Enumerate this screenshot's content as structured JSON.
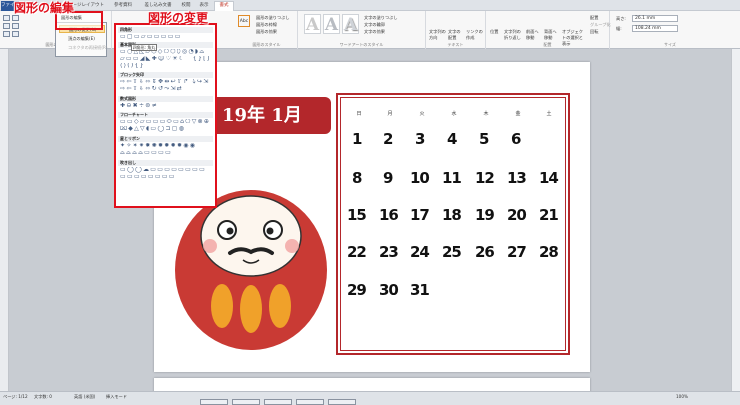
{
  "tabs": {
    "file": "ファイル",
    "items": [
      "ホーム",
      "挿入",
      "ページレイアウト",
      "参考資料",
      "差し込み文書",
      "校閲",
      "表示",
      "書式"
    ]
  },
  "ribbon": {
    "edit_shape": "図形の編集",
    "text_box": "テキスト ボックス",
    "group_insert_shape": "図形の挿入",
    "abc": "Abc",
    "shape_fill": "図形の塗りつぶし",
    "shape_outline": "図形の枠線",
    "shape_effect": "図形の効果",
    "group_shape_style": "図形のスタイル",
    "wordart_a": "A",
    "text_fill": "文字の塗りつぶし",
    "text_outline": "文字の輪郭",
    "text_effect": "文字の効果",
    "group_wordart": "ワードアートのスタイル",
    "text_direction": "文字列の方向",
    "text_align": "文字の配置",
    "create_link": "リンクの作成",
    "group_text": "テキスト",
    "position": "位置",
    "wrap": "文字列の折り返し",
    "forward": "前面へ移動",
    "backward": "背面へ移動",
    "selection_pane": "オブジェクトの選択と表示",
    "align": "配置",
    "group": "グループ化",
    "rotate": "回転",
    "group_arrange": "配置",
    "height_label": "高さ:",
    "height_value": "26.1 mm",
    "width_label": "幅:",
    "width_value": "108.24 mm",
    "group_size": "サイズ"
  },
  "annotations": {
    "edit_shape": "図形の編集",
    "change_shape": "図形の変更"
  },
  "dropdown_menu": {
    "items": [
      {
        "label": "図形の変更(N)",
        "state": "highlighted"
      },
      {
        "label": "頂点の編集(E)",
        "state": "normal"
      },
      {
        "label": "コネクタの再接続(R)",
        "state": "disabled"
      }
    ]
  },
  "shape_gallery": {
    "tooltip": "四角形: 角丸",
    "sections": [
      "四角形",
      "基本図形",
      "ブロック矢印",
      "数式図形",
      "フローチャート",
      "星とリボン",
      "吹き出し"
    ],
    "rows": [
      "▭▢▭▱▭▭▭▭▭",
      "▭○△◺▱⬡◇⬠⬡⬯◎◔◗⌓",
      "▱▭▭◢◣✚☺♡☀☾⌒{}[]",
      "⟨⟩(){}",
      "⇨⇦⇧⇩⬄⇕✥⇹↩⇧↱⤵↪⇲",
      "⇨⇦⇧⇩⬄↻↺⤳⇲⇄",
      "✚⊖✖÷⊜≠",
      "▭▭◇▱▭▭▭⬭▭⌂⬠▽⊗⊕",
      "⌧◆△▽◖▭◯⊐▢◍",
      "✦✧✶✷✸✺✹✹✹✹◉◉",
      "⌓⌓⌓⌓▭▭▭▭",
      "▭◯◯☁▭▭▭▭▭▭▭▭",
      "▭▭▭▭▭▭▭▭"
    ]
  },
  "page": {
    "banner": "19年 1月",
    "weekdays": [
      "日",
      "月",
      "火",
      "水",
      "木",
      "金",
      "土"
    ],
    "days": [
      [
        "1",
        "2",
        "3",
        "4",
        "5",
        "6"
      ],
      [
        "8",
        "9",
        "10",
        "11",
        "12",
        "13",
        "14"
      ],
      [
        "15",
        "16",
        "17",
        "18",
        "19",
        "20",
        "21"
      ],
      [
        "22",
        "23",
        "24",
        "25",
        "26",
        "27",
        "28"
      ],
      [
        "29",
        "30",
        "31"
      ]
    ]
  },
  "status": {
    "page": "ページ: 1/12",
    "words": "文字数: 0",
    "language": "英語 (米国)",
    "insert": "挿入モード",
    "zoom": "100%"
  },
  "colors": {
    "banner": "#b3272b",
    "annotation": "#e0101c",
    "accent": "#2b579a"
  }
}
